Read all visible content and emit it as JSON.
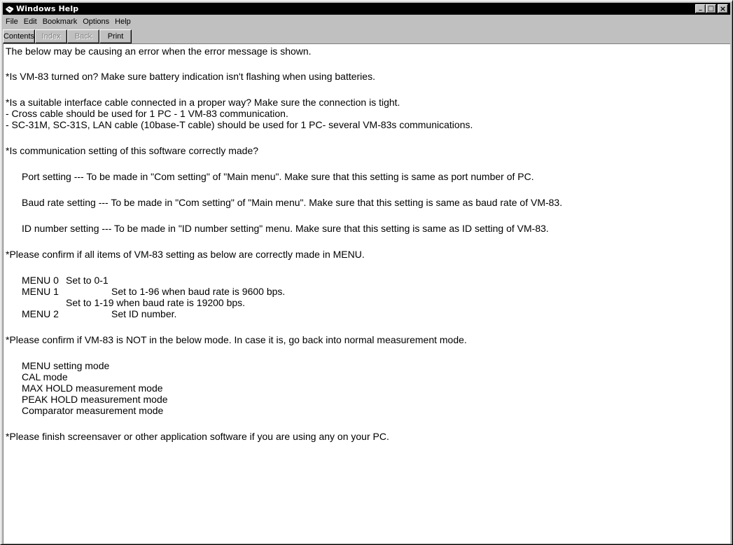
{
  "window": {
    "title": "Windows Help",
    "caption_buttons": {
      "minimize": "_",
      "maximize": "□",
      "close": "×"
    }
  },
  "menu": {
    "file": "File",
    "edit": "Edit",
    "bookmark": "Bookmark",
    "options": "Options",
    "help": "Help"
  },
  "toolbar": {
    "contents": "Contents",
    "index": "Index",
    "back": "Back",
    "print": "Print"
  },
  "content": {
    "intro": "The below may be causing an error when the error message is shown.",
    "q1": "*Is VM-83 turned on? Make sure battery indication isn't flashing when using batteries.",
    "q2": "*Is a suitable interface cable connected in a proper way? Make sure the connection is tight.",
    "q2_a": "- Cross cable should be used for 1 PC - 1 VM-83 communication.",
    "q2_b": "- SC-31M, SC-31S, LAN cable (10base-T cable) should be used for 1 PC- several VM-83s communications.",
    "q3": "*Is communication setting of this software correctly made?",
    "port": "Port setting --- To be made in \"Com setting\" of \"Main menu\". Make sure that this setting is same as port number of PC.",
    "baud": "Baud rate setting --- To be made in \"Com setting\" of \"Main menu\". Make sure that this setting is same as baud rate of VM-83.",
    "idnum": "ID number setting --- To be made in \"ID number setting\" menu. Make sure that this setting is same as ID setting of VM-83.",
    "q4": "*Please confirm if all items of VM-83 setting as below are correctly made in MENU.",
    "menu0_label": "MENU 0",
    "menu0_value": "Set to 0-1",
    "menu1_label": "MENU 1",
    "menu1_value": "Set to 1-96 when baud rate is 9600 bps.",
    "menu1_value2": "Set to 1-19 when baud rate is 19200 bps.",
    "menu2_label": "MENU 2",
    "menu2_value": "Set ID number.",
    "q5": "*Please confirm if VM-83 is NOT in the below mode. In case it is, go back into normal measurement mode.",
    "modes": [
      "MENU setting mode",
      "CAL mode",
      "MAX HOLD measurement mode",
      "PEAK HOLD measurement mode",
      "Comparator measurement mode"
    ],
    "q6": "*Please finish screensaver or other application software if you are using any on your PC."
  }
}
